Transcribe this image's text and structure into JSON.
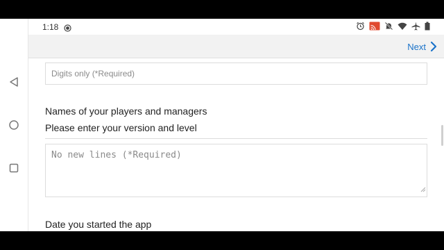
{
  "status_bar": {
    "time": "1:18",
    "icons": [
      "alarm-icon",
      "cast-icon",
      "notifications-off-icon",
      "wifi-icon",
      "airplane-icon",
      "battery-icon"
    ]
  },
  "toolbar": {
    "next_label": "Next"
  },
  "form": {
    "field1_placeholder": "Digits only (*Required)",
    "field1_value": "",
    "names_label": "Names of your players and managers",
    "version_label": "Please enter your version and level",
    "field2_placeholder": "No new lines (*Required)",
    "field2_value": "",
    "date_label": "Date you started the app"
  },
  "colors": {
    "accent": "#1b73c9",
    "toolbar_bg": "#f2f2f2",
    "border": "#dcdcdc"
  }
}
